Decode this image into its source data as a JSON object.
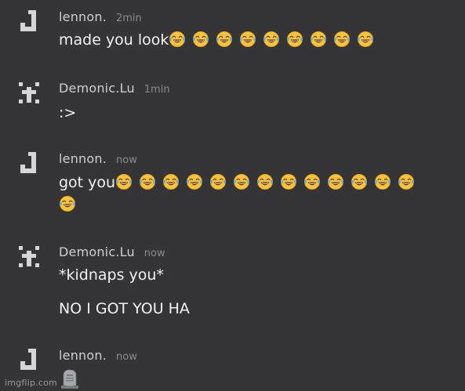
{
  "messages": [
    {
      "avatar_icon": "letter-j-avatar",
      "username": "lennon.",
      "timestamp": "2min",
      "lines": [
        "made you look"
      ],
      "emoji": "laughing-crying-emoji",
      "emoji_count": 9
    },
    {
      "avatar_icon": "pixel-cross-avatar",
      "username": "Demonic.Lu",
      "timestamp": "1min",
      "lines": [
        ":>"
      ]
    },
    {
      "avatar_icon": "letter-j-avatar",
      "username": "lennon.",
      "timestamp": "now",
      "lines": [
        "got you"
      ],
      "emoji": "laughing-crying-emoji",
      "emoji_count": 14
    },
    {
      "avatar_icon": "pixel-cross-avatar",
      "username": "Demonic.Lu",
      "timestamp": "now",
      "lines": [
        "*kidnaps you*",
        "NO I GOT YOU HA"
      ]
    },
    {
      "avatar_icon": "letter-j-avatar",
      "username": "lennon.",
      "timestamp": "now",
      "lines": [],
      "attachment_icon": "tombstone-emoji"
    }
  ],
  "watermark": "imgflip.com",
  "colors": {
    "background": "#353538",
    "username": "#cfcfcf",
    "timestamp": "#8a8a8c",
    "message_text": "#f2f2f2",
    "avatar": "#d6d6d6",
    "emoji_face": "#f6c33b"
  }
}
